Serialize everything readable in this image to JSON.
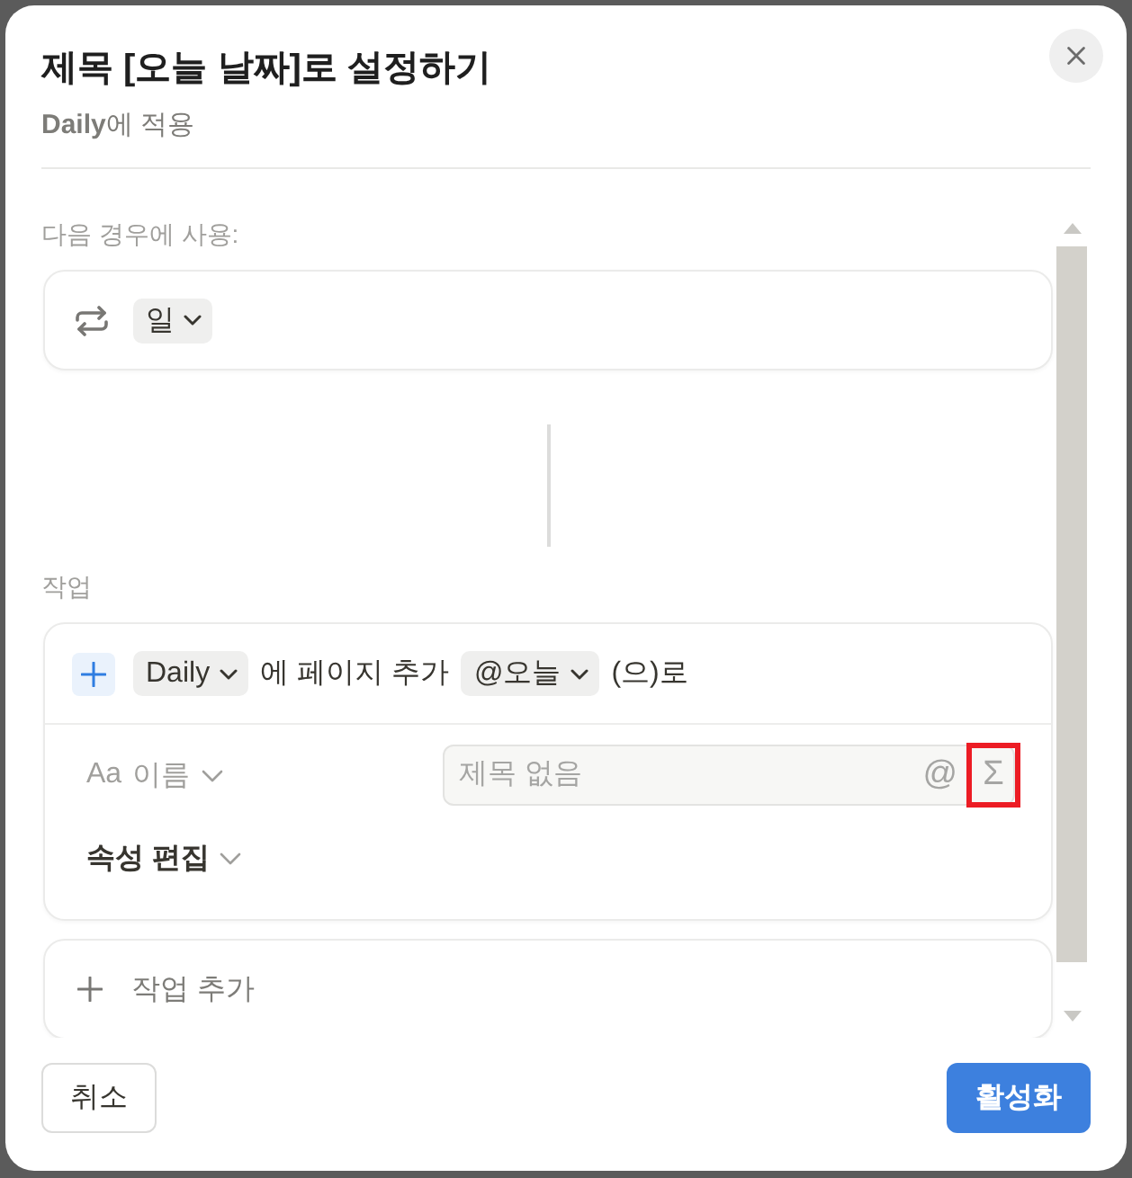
{
  "dialog": {
    "title": "제목 [오늘 날짜]로 설정하기",
    "subtitle": "**Daily**에 적용"
  },
  "trigger": {
    "label": "다음 경우에 사용:",
    "value": "일"
  },
  "actions_section": {
    "label": "작업"
  },
  "action": {
    "database": "Daily",
    "text_1": "에 페이지 추가",
    "date": "@오늘",
    "text_2": "(으)로",
    "property": {
      "icon_text": "Aa",
      "name": "이름"
    },
    "field": {
      "placeholder": "제목 없음",
      "mention_symbol": "@",
      "formula_symbol": "Σ",
      "formula_highlighted": true
    },
    "edit_properties": "속성 편집"
  },
  "add_action": {
    "label": "작업 추가"
  },
  "buttons": [
    {
      "label": "취소",
      "kind": "secondary"
    },
    {
      "label": "활성화",
      "kind": "primary"
    }
  ]
}
